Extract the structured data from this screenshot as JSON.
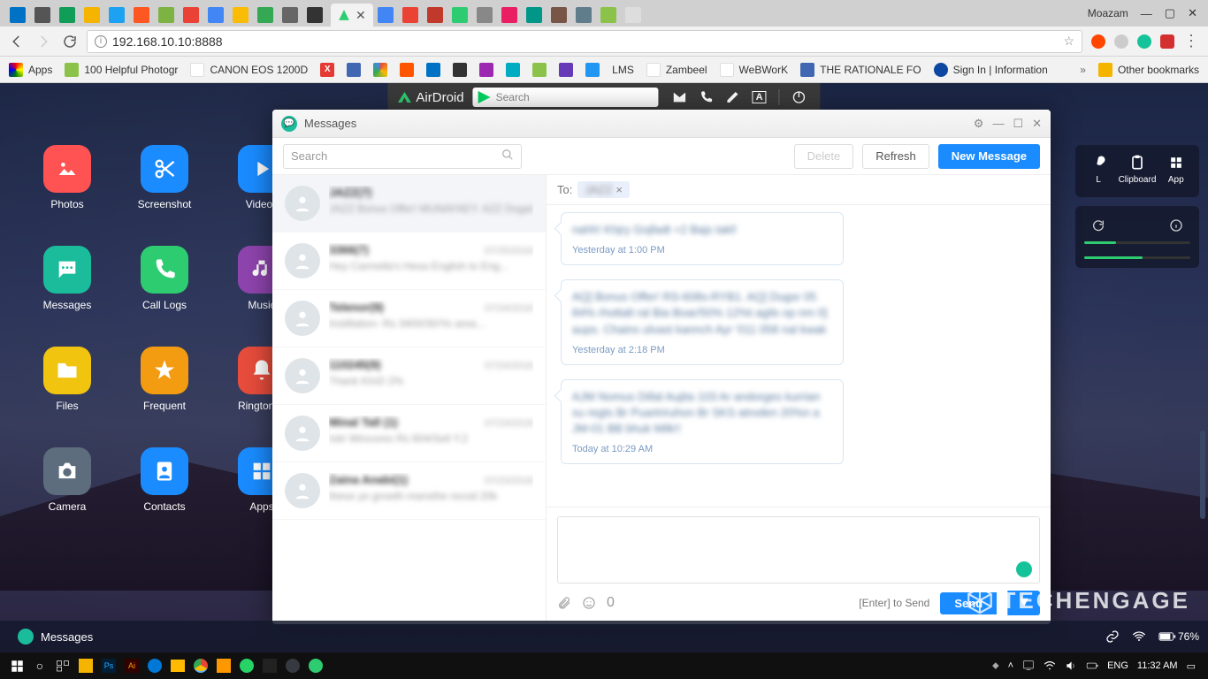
{
  "chrome": {
    "user": "Moazam",
    "url": "192.168.10.10:8888",
    "reload_tooltip": "Reload"
  },
  "bookmarks": {
    "apps": "Apps",
    "photo": "100 Helpful Photogr",
    "canon": "CANON EOS 1200D",
    "lms": "LMS",
    "zambeel": "Zambeel",
    "webwork": "WeBWorK",
    "rationale": "THE RATIONALE FO",
    "signin": "Sign In | Information",
    "other": "Other bookmarks"
  },
  "airdroid": {
    "logo": "AirDroid",
    "search_placeholder": "Search",
    "right_panel": {
      "url_label": "L",
      "clipboard": "Clipboard",
      "app": "App"
    }
  },
  "apps": {
    "photos": "Photos",
    "screenshot": "Screenshot",
    "videos": "Videos",
    "messages": "Messages",
    "calllogs": "Call Logs",
    "music": "Music",
    "files": "Files",
    "frequent": "Frequent",
    "ringtones": "Ringtones",
    "camera": "Camera",
    "contacts": "Contacts",
    "apps_label": "Apps"
  },
  "window": {
    "title": "Messages",
    "search_placeholder": "Search",
    "delete": "Delete",
    "refresh": "Refresh",
    "new_message": "New Message",
    "to_label": "To:",
    "to_value": "JAZZ",
    "compose_hint": "[Enter] to Send",
    "send": "Send",
    "char_count": "0"
  },
  "conversations": [
    {
      "name": "JAZZ(7)",
      "time": "",
      "preview": "JAZZ Bonus Offer! MUNAFAEY. AZZ Dugal"
    },
    {
      "name": "3366(7)",
      "time": "07/25/2018",
      "preview": "Hey Carmella's Hesa English to Eng..."
    },
    {
      "name": "Telenor(9)",
      "time": "07/24/2018",
      "preview": "Instillation- Rs 3400/30/Yo area..."
    },
    {
      "name": "110245(9)",
      "time": "07/24/2018",
      "preview": "Thank KInD 2%"
    },
    {
      "name": "Minal Tall (1)",
      "time": "07/23/2018",
      "preview": "Istir Wincorex Rs 604/Sell Y.2"
    },
    {
      "name": "Zaina Anabi(1)",
      "time": "07/23/2018",
      "preview": "these ye growth mansthe recod 20k"
    }
  ],
  "messages": [
    {
      "body": "nahh! Khjry Gojfadt +2 Bajs takl!",
      "time": "Yesterday at 1:00 PM"
    },
    {
      "body": "AQ] Bonus Offer! RS-608s-RYB1. AQ] Dugsr 05 84% rhottalt ral Bia Boar/50% 12%t agils op nm 0] aups. Chains ulvast kannch Ayr '011 058 nal kwak",
      "time": "Yesterday at 2:18 PM"
    },
    {
      "body": "AJM Nomus Dillal Aujita 103 Ar andorges kurrian su regts Br Puartriruhon Br SKS atroden 20%n a JM-01 BB bhuk Milk!!",
      "time": "Today at 10:29 AM"
    }
  ],
  "taskbar": {
    "messages": "Messages",
    "battery": "76%"
  },
  "watermark": "TECHENGAGE",
  "windows": {
    "lang": "ENG",
    "time": "11:32 AM"
  }
}
